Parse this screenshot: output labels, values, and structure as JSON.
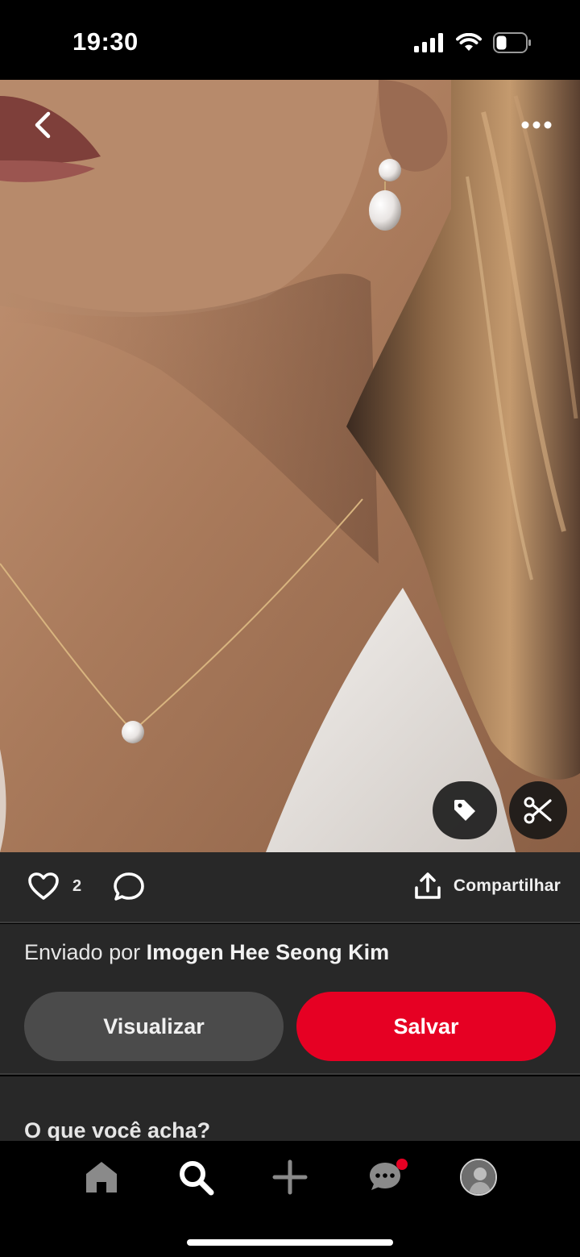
{
  "status_bar": {
    "time": "19:30",
    "icons": [
      "signal-icon",
      "wifi-icon",
      "battery-icon"
    ]
  },
  "pin": {
    "image_description_icon": "photo",
    "top_actions": {
      "back_icon": "chevron-left-icon",
      "more_icon": "more-horizontal-icon"
    },
    "overlay_buttons": [
      "tag-icon",
      "scissors-icon"
    ]
  },
  "actions": {
    "like_count": "2",
    "share_label": "Compartilhar"
  },
  "uploader": {
    "prefix": "Enviado por ",
    "name": "Imogen Hee Seong Kim"
  },
  "buttons": {
    "view": "Visualizar",
    "save": "Salvar"
  },
  "comments": {
    "title": "O que você acha?"
  },
  "tab_bar": {
    "items": [
      "home-icon",
      "search-icon",
      "plus-icon",
      "messages-icon",
      "profile-avatar"
    ],
    "active": "search-icon"
  },
  "colors": {
    "accent": "#e60023",
    "surface": "#282828",
    "secondary_button": "#4b4b4b"
  }
}
